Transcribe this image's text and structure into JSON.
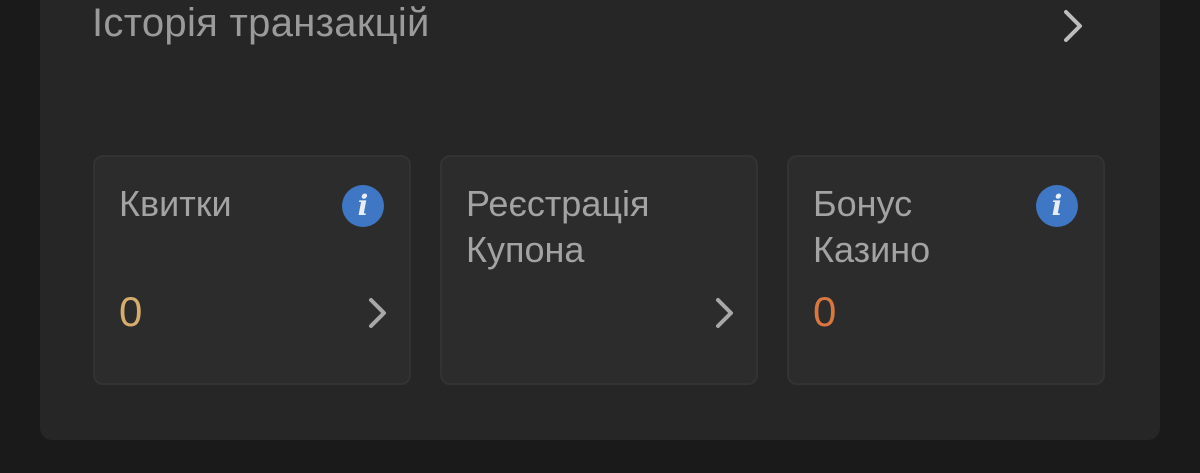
{
  "history": {
    "title": "Історія транзакцій",
    "chevron_icon": "chevron-right-icon"
  },
  "cards": [
    {
      "title": "Квитки",
      "value": "0",
      "value_color": "#d6ad6c",
      "has_info": true,
      "info_icon": "info-icon",
      "info_glyph": "i",
      "has_chevron": true
    },
    {
      "title": "Реєстрація\nКупона",
      "has_info": false,
      "has_chevron": true
    },
    {
      "title": "Бонус\nКазино",
      "value": "0",
      "value_color": "#d9773f",
      "has_info": true,
      "info_icon": "info-icon",
      "info_glyph": "i",
      "has_chevron": false
    }
  ],
  "colors": {
    "background": "#1a1a1a",
    "panel": "#262626",
    "card": "#2c2c2c",
    "info_blue": "#3f77c4",
    "text_muted": "#9a9a9a"
  }
}
